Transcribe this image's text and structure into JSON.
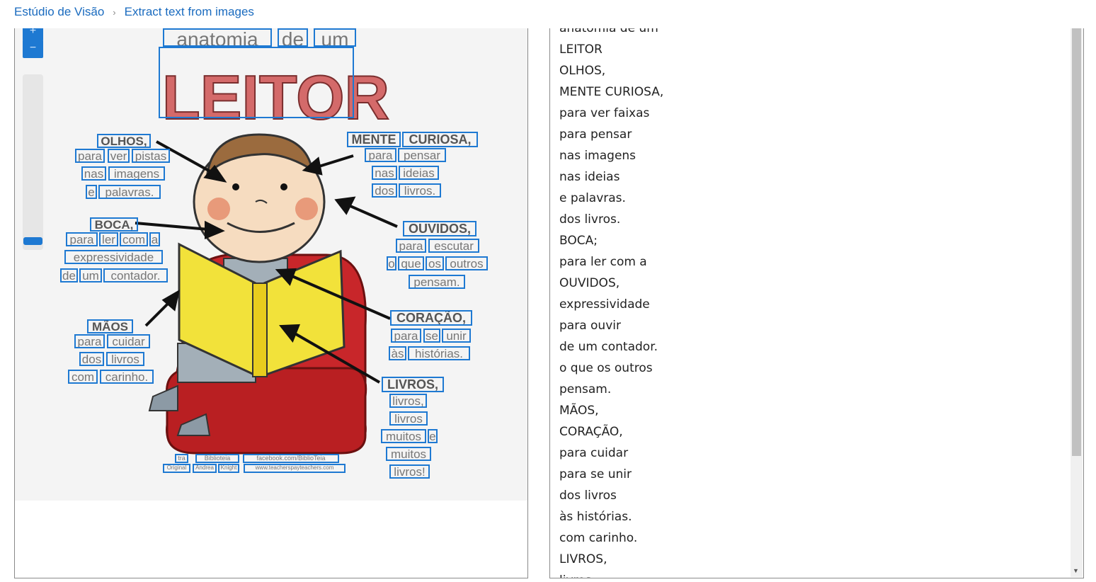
{
  "breadcrumb": {
    "home": "Estúdio de Visão",
    "separator": "›",
    "current": "Extract text from images"
  },
  "zoom": {
    "in_icon": "+",
    "out_icon": "−"
  },
  "image": {
    "words": {
      "anatomia": "anatomia",
      "de": "de",
      "um": "um",
      "leitor": "LEITOR",
      "olhos": "OLHOS,",
      "olhos_para": "para",
      "olhos_ver": "ver",
      "olhos_pistas": "pistas",
      "olhos_nas": "nas",
      "olhos_imagens": "imagens",
      "olhos_e": "e",
      "olhos_palavras": "palavras.",
      "mente": "MENTE",
      "curiosa": "CURIOSA,",
      "mente_para": "para",
      "mente_pensar": "pensar",
      "mente_nas": "nas",
      "mente_ideias": "ideias",
      "mente_dos": "dos",
      "mente_livros": "livros.",
      "boca": "BOCA,",
      "boca_para": "para",
      "boca_ler": "ler",
      "boca_com": "com",
      "boca_a": "a",
      "boca_expressividade": "expressividade",
      "boca_de": "de",
      "boca_um": "um",
      "boca_contador": "contador.",
      "ouvidos": "OUVIDOS,",
      "ouvidos_para": "para",
      "ouvidos_escutar": "escutar",
      "ouvidos_o": "o",
      "ouvidos_que": "que",
      "ouvidos_os": "os",
      "ouvidos_outros": "outros",
      "ouvidos_pensam": "pensam.",
      "coracao": "CORAÇÃO,",
      "coracao_para": "para",
      "coracao_se": "se",
      "coracao_unir": "unir",
      "coracao_as": "às",
      "coracao_historias": "histórias.",
      "maos": "MÃOS",
      "maos_para": "para",
      "maos_cuidar": "cuidar",
      "maos_dos": "dos",
      "maos_livros": "livros",
      "maos_com": "com",
      "maos_carinho": "carinho.",
      "livros_title": "LIVROS,",
      "livros_1": "livros,",
      "livros_2": "livros",
      "livros_muitos": "muitos",
      "livros_e": "e",
      "livros_muitos2": "muitos",
      "livros_3": "livros!",
      "credit_1": "tra",
      "credit_2": "Biblioteia",
      "credit_3": "facebook.com/BiblioTeia",
      "credit_4": "Original",
      "credit_5": "Andrea",
      "credit_6": "Knight",
      "credit_7": "www.teacherspayteachers.com"
    }
  },
  "result_lines": [
    "anatomia de um",
    "LEITOR",
    "OLHOS,",
    "MENTE CURIOSA,",
    "para ver faixas",
    "para pensar",
    "nas imagens",
    "nas ideias",
    "e palavras.",
    "dos livros.",
    "BOCA;",
    "para ler com a",
    "OUVIDOS,",
    "expressividade",
    "para ouvir",
    "de um contador.",
    "o que os outros",
    "pensam.",
    "MÃOS,",
    "CORAÇÃO,",
    "para cuidar",
    "para se unir",
    "dos livros",
    "às histórias.",
    "com carinho.",
    "LIVROS,",
    "livros,"
  ],
  "colors": {
    "accent": "#1e79d2",
    "book": "#f2e23a",
    "chair": "#c8262a",
    "leitor": "#d46a6a"
  }
}
